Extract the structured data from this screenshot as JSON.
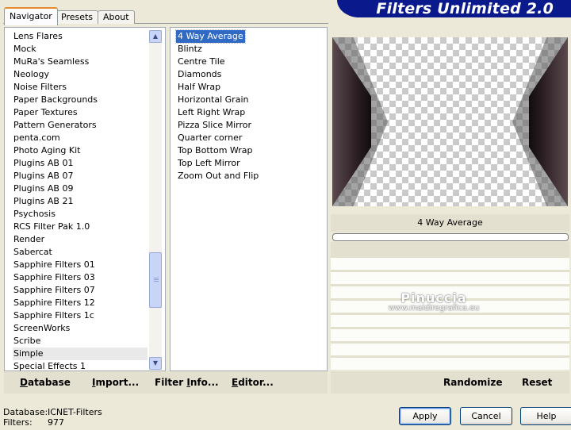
{
  "app": {
    "title": "Filters Unlimited 2.0"
  },
  "tabs": [
    {
      "label": "Navigator",
      "active": true
    },
    {
      "label": "Presets",
      "active": false
    },
    {
      "label": "About",
      "active": false
    }
  ],
  "categories": {
    "items": [
      "Lens Flares",
      "Mock",
      "MuRa's Seamless",
      "Neology",
      "Noise Filters",
      "Paper Backgrounds",
      "Paper Textures",
      "Pattern Generators",
      "penta.com",
      "Photo Aging Kit",
      "Plugins AB 01",
      "Plugins AB 07",
      "Plugins AB 09",
      "Plugins AB 21",
      "Psychosis",
      "RCS Filter Pak 1.0",
      "Render",
      "Sabercat",
      "Sapphire Filters 01",
      "Sapphire Filters 03",
      "Sapphire Filters 07",
      "Sapphire Filters 12",
      "Sapphire Filters 1c",
      "ScreenWorks",
      "Scribe",
      "Simple",
      "Special Effects 1"
    ],
    "selected": "Simple"
  },
  "filters": {
    "items": [
      "4 Way Average",
      "Blintz",
      "Centre Tile",
      "Diamonds",
      "Half Wrap",
      "Horizontal Grain",
      "Left Right Wrap",
      "Pizza Slice Mirror",
      "Quarter corner",
      "Top Bottom Wrap",
      "Top Left Mirror",
      "Zoom Out and Flip"
    ],
    "selected": "4 Way Average"
  },
  "preview": {
    "filter_name": "4 Way Average"
  },
  "watermark": {
    "name": "Pinuccia",
    "url": "www.maidiregrafica.eu"
  },
  "toolbar": {
    "database": {
      "first": "D",
      "rest": "atabase"
    },
    "import": {
      "first": "I",
      "rest": "mport..."
    },
    "filter_info": {
      "pre": "Filter ",
      "first": "I",
      "rest": "nfo..."
    },
    "editor": {
      "first": "E",
      "rest": "ditor..."
    },
    "randomize": "Randomize",
    "reset": "Reset"
  },
  "status": {
    "database_label": "Database:",
    "database_value": "ICNET-Filters",
    "filters_label": "Filters:",
    "filters_value": "977"
  },
  "buttons": {
    "apply": "Apply",
    "cancel": "Cancel",
    "help": "Help"
  },
  "icons": {
    "scroll_up": "chevron-up-icon",
    "scroll_down": "chevron-down-icon"
  },
  "colors": {
    "banner": "#0a1a8c",
    "selection": "#316ac5",
    "face": "#ece9d8"
  }
}
